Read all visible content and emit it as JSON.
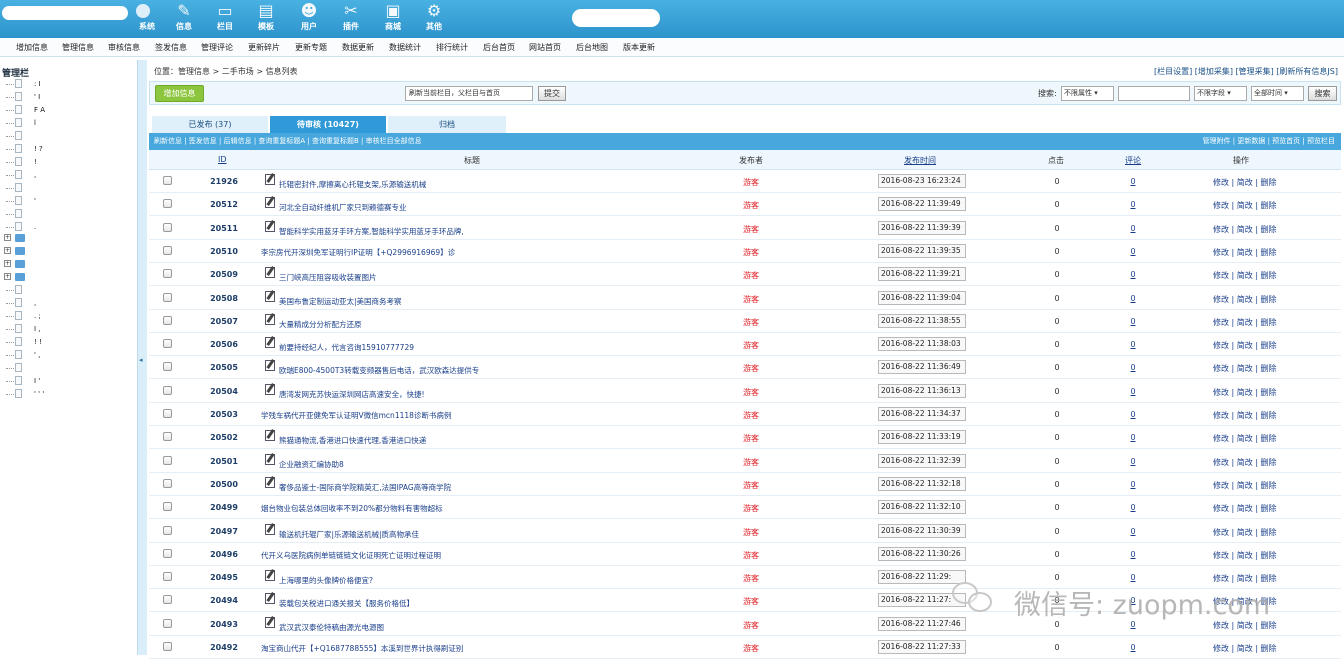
{
  "topnav": [
    {
      "label": "系统",
      "icon": "system-icon"
    },
    {
      "label": "信息",
      "icon": "pencil-icon"
    },
    {
      "label": "栏目",
      "icon": "folder-icon"
    },
    {
      "label": "模板",
      "icon": "template-icon"
    },
    {
      "label": "用户",
      "icon": "user-icon"
    },
    {
      "label": "插件",
      "icon": "plugin-icon"
    },
    {
      "label": "商城",
      "icon": "shop-icon"
    },
    {
      "label": "其他",
      "icon": "gear-icon"
    }
  ],
  "menu": [
    "增加信息",
    "管理信息",
    "审核信息",
    "签发信息",
    "管理评论",
    "更新碎片",
    "更新专题",
    "数据更新",
    "数据统计",
    "排行统计",
    "后台首页",
    "网站首页",
    "后台地图",
    "版本更新"
  ],
  "tree": {
    "title": "管理栏"
  },
  "breadcrumb": "位置：管理信息 > 二手市场 > 信息列表",
  "top_links": "[栏目设置] [增加采集] [管理采集] [刷新所有信息JS]",
  "toolbar": {
    "add_label": "增加信息",
    "refresh_select": "刷新当前栏目，父栏目与首页",
    "submit_label": "提交",
    "search_label": "搜索:",
    "attr_select": "不限属性",
    "search_value": "",
    "field_select": "不限字段",
    "time_select": "全部时间",
    "search_button": "搜索"
  },
  "tabs": {
    "published": "已发布 (37)",
    "pending": "待审核 (10427)",
    "archive": "归档"
  },
  "subbar": {
    "left": "刷新信息 | 签发信息 | 后辑信息 | 查询重复标题A | 查询重复标题B | 审核栏目全部信息",
    "right": "管理附件 | 更新数据 | 预览首页 | 预览栏目"
  },
  "columns": {
    "id": "ID",
    "title": "标题",
    "author": "发布者",
    "time": "发布时间",
    "clicks": "点击",
    "comments": "评论",
    "ops": "操作"
  },
  "row_ops": "修改 | 简改 | 删除",
  "rows": [
    {
      "id": "21926",
      "title": "托辊密封件,摩擦离心托辊支架,乐源输送机械",
      "author": "游客",
      "time": "2016-08-23 16:23:24",
      "clicks": "0",
      "comments": "0",
      "icon": true
    },
    {
      "id": "20512",
      "title": "河北全自动纤维机厂家只到赖德赛专业",
      "author": "游客",
      "time": "2016-08-22 11:39:49",
      "clicks": "0",
      "comments": "0",
      "icon": true
    },
    {
      "id": "20511",
      "title": "智能科学实用蓝牙手环方案,智能科学实用蓝牙手环品牌,",
      "author": "游客",
      "time": "2016-08-22 11:39:39",
      "clicks": "0",
      "comments": "0",
      "icon": true
    },
    {
      "id": "20510",
      "title": "李宗房代开深圳免军证明行IP证明【+Q2996916969】诊",
      "author": "游客",
      "time": "2016-08-22 11:39:35",
      "clicks": "0",
      "comments": "0",
      "icon": false
    },
    {
      "id": "20509",
      "title": "三门峡高压阻容吸收装置图片",
      "author": "游客",
      "time": "2016-08-22 11:39:21",
      "clicks": "0",
      "comments": "0",
      "icon": true
    },
    {
      "id": "20508",
      "title": "美国布鲁定制运动亚太|美国商务考察",
      "author": "游客",
      "time": "2016-08-22 11:39:04",
      "clicks": "0",
      "comments": "0",
      "icon": true
    },
    {
      "id": "20507",
      "title": "大量精成分分析配方还原",
      "author": "游客",
      "time": "2016-08-22 11:38:55",
      "clicks": "0",
      "comments": "0",
      "icon": true
    },
    {
      "id": "20506",
      "title": "前要持经纪人，代言咨询15910777729",
      "author": "游客",
      "time": "2016-08-22 11:38:03",
      "clicks": "0",
      "comments": "0",
      "icon": true
    },
    {
      "id": "20505",
      "title": "欧瑞E800-4500T3转载变频器售后电话，武汉欧森达提供专",
      "author": "游客",
      "time": "2016-08-22 11:36:49",
      "clicks": "0",
      "comments": "0",
      "icon": true
    },
    {
      "id": "20504",
      "title": "唐湾发网克苏快运深圳网店高速安全，快捷!",
      "author": "游客",
      "time": "2016-08-22 11:36:13",
      "clicks": "0",
      "comments": "0",
      "icon": true
    },
    {
      "id": "20503",
      "title": "学残车祸代开亚健免军认证明V微信mcn1118诊断书病例",
      "author": "游客",
      "time": "2016-08-22 11:34:37",
      "clicks": "0",
      "comments": "0",
      "icon": false
    },
    {
      "id": "20502",
      "title": "熊猫通物流,香港进口快速代理,香港进口快递",
      "author": "游客",
      "time": "2016-08-22 11:33:19",
      "clicks": "0",
      "comments": "0",
      "icon": true
    },
    {
      "id": "20501",
      "title": "企业融资汇编协助8",
      "author": "游客",
      "time": "2016-08-22 11:32:39",
      "clicks": "0",
      "comments": "0",
      "icon": true
    },
    {
      "id": "20500",
      "title": "奢侈品鉴士-国际商学院精英汇,法国IPAG高等商学院",
      "author": "游客",
      "time": "2016-08-22 11:32:18",
      "clicks": "0",
      "comments": "0",
      "icon": true
    },
    {
      "id": "20499",
      "title": "烟台物业包装总体回收率不到20%都分物料有害物超标",
      "author": "游客",
      "time": "2016-08-22 11:32:10",
      "clicks": "0",
      "comments": "0",
      "icon": false
    },
    {
      "id": "20497",
      "title": "输送机托辊厂家|乐源输送机械|质高物承佳",
      "author": "游客",
      "time": "2016-08-22 11:30:39",
      "clicks": "0",
      "comments": "0",
      "icon": true
    },
    {
      "id": "20496",
      "title": "代开义乌医院病例单链链链文化证明死亡证明过程证明",
      "author": "游客",
      "time": "2016-08-22 11:30:26",
      "clicks": "0",
      "comments": "0",
      "icon": false
    },
    {
      "id": "20495",
      "title": "上海哪里的头像牌价格便宜?",
      "author": "游客",
      "time": "2016-08-22 11:29:",
      "clicks": "0",
      "comments": "0",
      "icon": true
    },
    {
      "id": "20494",
      "title": "装载包关税进口通关报关【服务价格低】",
      "author": "游客",
      "time": "2016-08-22 11:27:",
      "clicks": "0",
      "comments": "0",
      "icon": true
    },
    {
      "id": "20493",
      "title": "武汉武汉泰伦特稿由源光电源图",
      "author": "游客",
      "time": "2016-08-22 11:27:46",
      "clicks": "0",
      "comments": "0",
      "icon": true
    },
    {
      "id": "20492",
      "title": "淘宝商山代开【+Q1687788555】本溪到世界计执得刷证别",
      "author": "游客",
      "time": "2016-08-22 11:27:33",
      "clicks": "0",
      "comments": "0",
      "icon": false
    }
  ],
  "watermark": "微信号: zuopm.com"
}
